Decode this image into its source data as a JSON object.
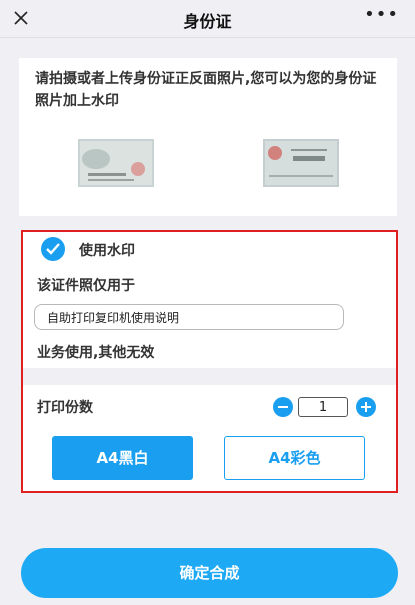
{
  "header": {
    "title": "身份证",
    "more_label": "•••"
  },
  "intro": {
    "text": "请拍摄或者上传身份证正反面照片,您可以为您的身份证照片加上水印",
    "front_photo_lines": [
      "中华人民共和国",
      "居民身份证"
    ],
    "back_photo_lines": [
      "住址",
      "公民身份号码"
    ]
  },
  "watermark": {
    "checked": true,
    "enable_label": "使用水印",
    "usage_label": "该证件照仅用于",
    "input_value": "自助打印复印机使用说明",
    "footer_label": "业务使用,其他无效"
  },
  "copies": {
    "label": "打印份数",
    "value": "1"
  },
  "print_modes": {
    "bw_label": "A4黑白",
    "color_label": "A4彩色",
    "selected": "bw"
  },
  "confirm_label": "确定合成",
  "colors": {
    "accent": "#1a9ff0",
    "highlight_border": "#e02020",
    "background": "#efeff4"
  }
}
